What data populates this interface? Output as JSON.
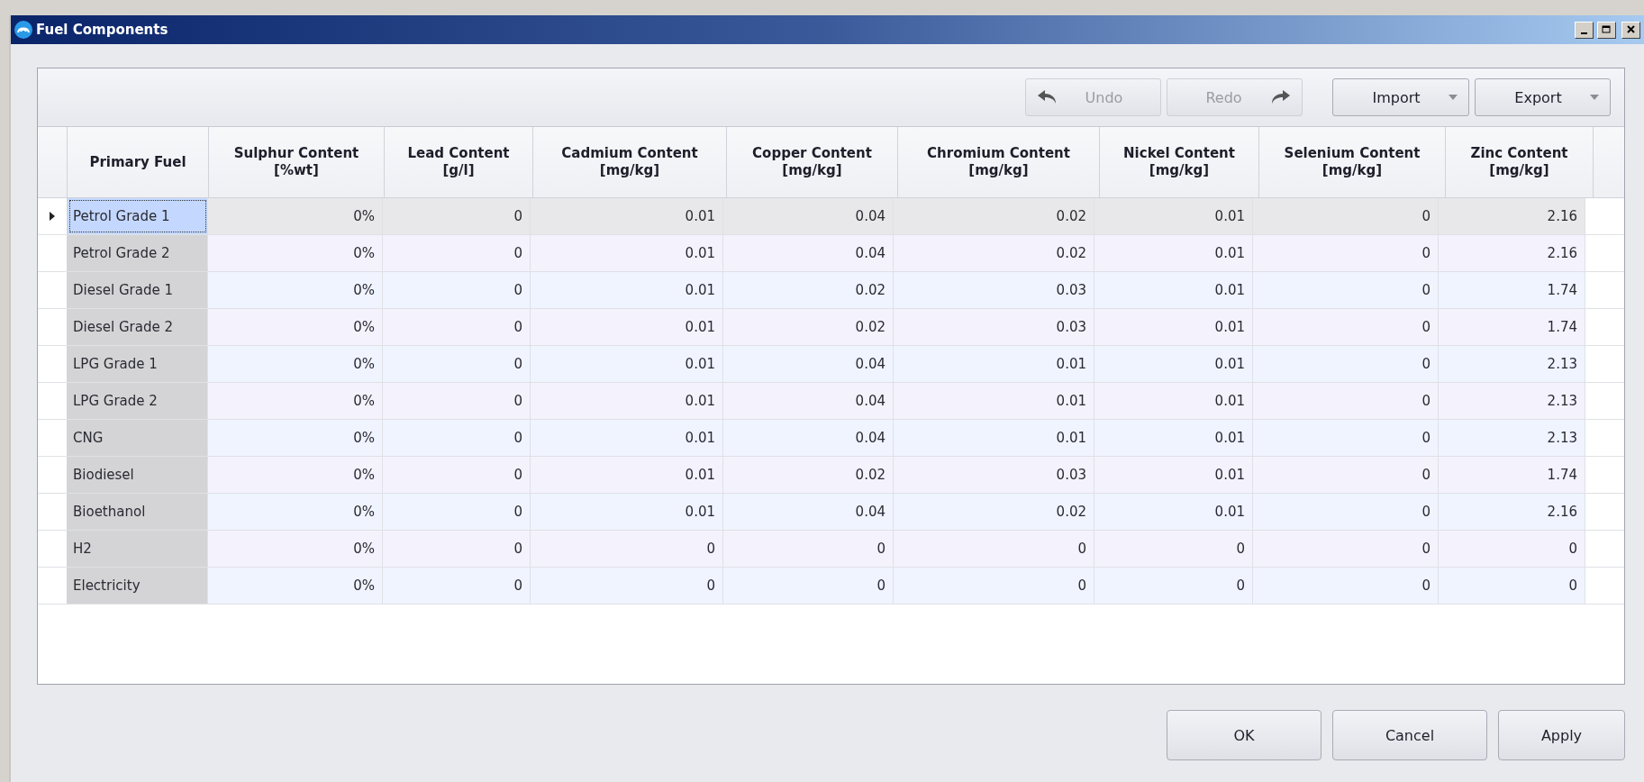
{
  "window": {
    "title": "Fuel Components"
  },
  "toolbar": [
    {
      "label": "Undo",
      "kind": "undo",
      "disabled": true
    },
    {
      "label": "Redo",
      "kind": "redo",
      "disabled": true
    },
    {
      "label": "Import",
      "kind": "dropdown",
      "disabled": false
    },
    {
      "label": "Export",
      "kind": "dropdown",
      "disabled": false
    }
  ],
  "table": {
    "columns": [
      "Primary Fuel",
      "Sulphur Content\n[%wt]",
      "Lead Content\n[g/l]",
      "Cadmium Content\n[mg/kg]",
      "Copper Content\n[mg/kg]",
      "Chromium Content\n[mg/kg]",
      "Nickel Content\n[mg/kg]",
      "Selenium Content\n[mg/kg]",
      "Zinc Content\n[mg/kg]"
    ],
    "rows": [
      {
        "selected": true,
        "cells": [
          "Petrol Grade 1",
          "0%",
          "0",
          "0.01",
          "0.04",
          "0.02",
          "0.01",
          "0",
          "2.16"
        ]
      },
      {
        "selected": false,
        "cells": [
          "Petrol Grade 2",
          "0%",
          "0",
          "0.01",
          "0.04",
          "0.02",
          "0.01",
          "0",
          "2.16"
        ]
      },
      {
        "selected": false,
        "cells": [
          "Diesel Grade 1",
          "0%",
          "0",
          "0.01",
          "0.02",
          "0.03",
          "0.01",
          "0",
          "1.74"
        ]
      },
      {
        "selected": false,
        "cells": [
          "Diesel Grade 2",
          "0%",
          "0",
          "0.01",
          "0.02",
          "0.03",
          "0.01",
          "0",
          "1.74"
        ]
      },
      {
        "selected": false,
        "cells": [
          "LPG Grade 1",
          "0%",
          "0",
          "0.01",
          "0.04",
          "0.01",
          "0.01",
          "0",
          "2.13"
        ]
      },
      {
        "selected": false,
        "cells": [
          "LPG Grade 2",
          "0%",
          "0",
          "0.01",
          "0.04",
          "0.01",
          "0.01",
          "0",
          "2.13"
        ]
      },
      {
        "selected": false,
        "cells": [
          "CNG",
          "0%",
          "0",
          "0.01",
          "0.04",
          "0.01",
          "0.01",
          "0",
          "2.13"
        ]
      },
      {
        "selected": false,
        "cells": [
          "Biodiesel",
          "0%",
          "0",
          "0.01",
          "0.02",
          "0.03",
          "0.01",
          "0",
          "1.74"
        ]
      },
      {
        "selected": false,
        "cells": [
          "Bioethanol",
          "0%",
          "0",
          "0.01",
          "0.04",
          "0.02",
          "0.01",
          "0",
          "2.16"
        ]
      },
      {
        "selected": false,
        "cells": [
          "H2",
          "0%",
          "0",
          "0",
          "0",
          "0",
          "0",
          "0",
          "0"
        ]
      },
      {
        "selected": false,
        "cells": [
          "Electricity",
          "0%",
          "0",
          "0",
          "0",
          "0",
          "0",
          "0",
          "0"
        ]
      }
    ]
  },
  "buttons": [
    "OK",
    "Cancel",
    "Apply"
  ]
}
